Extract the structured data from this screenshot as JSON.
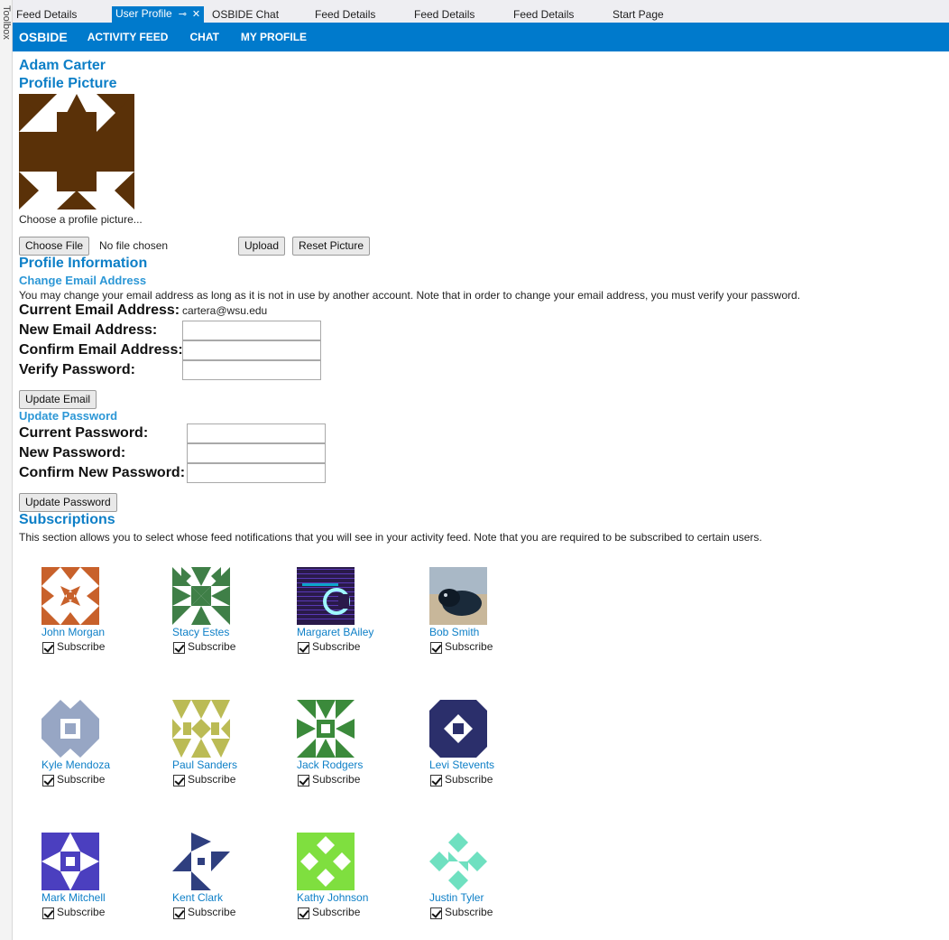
{
  "sidebar": {
    "toolbox_label": "Toolbox"
  },
  "tabs": [
    {
      "label": "Feed Details",
      "active": false
    },
    {
      "label": "User Profile",
      "active": true,
      "pin": "⊸",
      "close": "✕"
    },
    {
      "label": "OSBIDE Chat",
      "active": false
    },
    {
      "label": "Feed Details",
      "active": false
    },
    {
      "label": "Feed Details",
      "active": false
    },
    {
      "label": "Feed Details",
      "active": false
    },
    {
      "label": "Start Page",
      "active": false
    }
  ],
  "nav": {
    "brand": "OSBIDE",
    "links": [
      "ACTIVITY FEED",
      "CHAT",
      "MY PROFILE"
    ],
    "bg_color": "#007acc"
  },
  "profile": {
    "name": "Adam Carter",
    "picture_heading": "Profile Picture",
    "picture_color": "#5a3108",
    "choose_hint": "Choose a profile picture...",
    "choose_file_button": "Choose File",
    "no_file_text": "No file chosen",
    "upload_button": "Upload",
    "reset_button": "Reset Picture"
  },
  "info": {
    "heading": "Profile Information",
    "email": {
      "heading": "Change Email Address",
      "description": "You may change your email address as long as it is not in use by another account. Note that in order to change your email address, you must verify your password.",
      "current_label": "Current Email Address:",
      "current_value": "cartera@wsu.edu",
      "new_label": "New Email Address:",
      "confirm_label": "Confirm Email Address:",
      "verify_label": "Verify Password:",
      "button": "Update Email"
    },
    "password": {
      "heading": "Update Password",
      "current_label": "Current Password:",
      "new_label": "New Password:",
      "confirm_label": "Confirm New Password:",
      "button": "Update Password"
    }
  },
  "subscriptions": {
    "heading": "Subscriptions",
    "description": "This section allows you to select whose feed notifications that you will see in your activity feed. Note that you are required to be subscribed to certain users.",
    "checkbox_label": "Subscribe",
    "users": [
      {
        "name": "John Morgan",
        "color": "#c8612b",
        "pattern": "A",
        "checked": true
      },
      {
        "name": "Stacy Estes",
        "color": "#3f7f47",
        "pattern": "B",
        "checked": true
      },
      {
        "name": "Margaret BAiley",
        "color": "#2a1a4a",
        "pattern": "photo-c",
        "checked": true
      },
      {
        "name": "Bob Smith",
        "color": "#1a2a3a",
        "pattern": "photo-dog",
        "checked": true
      },
      {
        "name": "Kyle Mendoza",
        "color": "#97a6c4",
        "pattern": "C",
        "checked": true
      },
      {
        "name": "Paul Sanders",
        "color": "#bbbb55",
        "pattern": "D",
        "checked": true
      },
      {
        "name": "Jack Rodgers",
        "color": "#3b8a3b",
        "pattern": "E",
        "checked": true
      },
      {
        "name": "Levi Stevents",
        "color": "#2b2f6b",
        "pattern": "F",
        "checked": true
      },
      {
        "name": "Mark Mitchell",
        "color": "#4b3fbf",
        "pattern": "G",
        "checked": true
      },
      {
        "name": "Kent Clark",
        "color": "#2f3f7f",
        "pattern": "H",
        "checked": true
      },
      {
        "name": "Kathy Johnson",
        "color": "#7fdf3f",
        "pattern": "I",
        "checked": true
      },
      {
        "name": "Justin Tyler",
        "color": "#6fe0c0",
        "pattern": "J",
        "checked": true
      }
    ]
  }
}
